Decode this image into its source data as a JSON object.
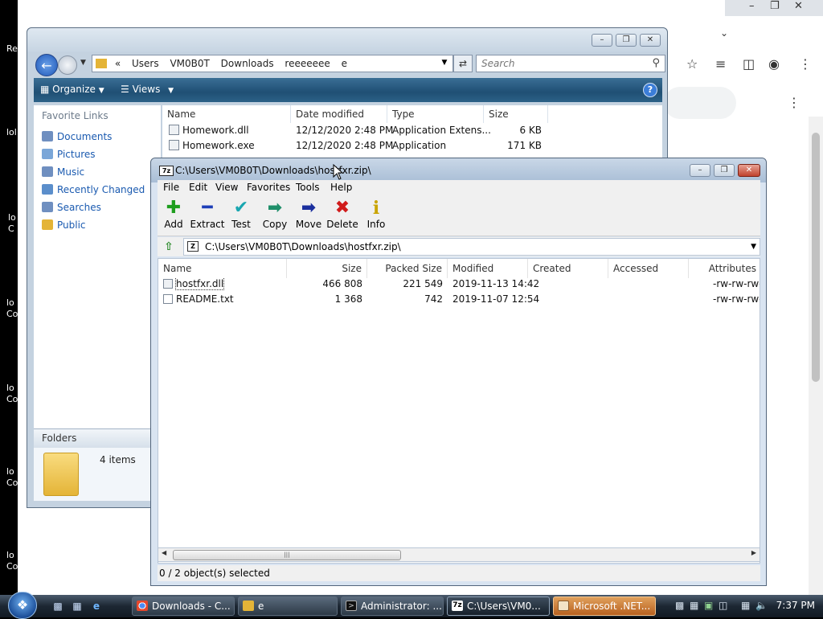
{
  "desktop": {
    "labels": [
      "Re",
      "lol",
      "lo\nC",
      "lo\nCo",
      "lo\nCo",
      "lo\nCo",
      "lo\nCo"
    ]
  },
  "explorer": {
    "breadcrumb": [
      "«",
      "Users",
      "VM0B0T",
      "Downloads",
      "reeeeeee",
      "e"
    ],
    "search_placeholder": "Search",
    "organize_label": "Organize",
    "views_label": "Views",
    "favorites_title": "Favorite Links",
    "favorites": [
      {
        "label": "Documents",
        "color": "#6f8fc0"
      },
      {
        "label": "Pictures",
        "color": "#7aa6d8"
      },
      {
        "label": "Music",
        "color": "#6f8fc0"
      },
      {
        "label": "Recently Changed",
        "color": "#5b8ecb"
      },
      {
        "label": "Searches",
        "color": "#6f8fc0"
      },
      {
        "label": "Public",
        "color": "#e4b437"
      }
    ],
    "folders_label": "Folders",
    "items_count": "4 items",
    "columns": [
      "Name",
      "Date modified",
      "Type",
      "Size"
    ],
    "files": [
      {
        "name": "Homework.dll",
        "date": "12/12/2020 2:48 PM",
        "type": "Application Extens...",
        "size": "6 KB"
      },
      {
        "name": "Homework.exe",
        "date": "12/12/2020 2:48 PM",
        "type": "Application",
        "size": "171 KB"
      }
    ]
  },
  "zip": {
    "title": "C:\\Users\\VM0B0T\\Downloads\\hostfxr.zip\\",
    "menu": [
      "File",
      "Edit",
      "View",
      "Favorites",
      "Tools",
      "Help"
    ],
    "toolbar": [
      {
        "label": "Add",
        "glyph": "✚",
        "color": "#1f9e1f"
      },
      {
        "label": "Extract",
        "glyph": "━",
        "color": "#1d3fb8"
      },
      {
        "label": "Test",
        "glyph": "✔",
        "color": "#19a6b0"
      },
      {
        "label": "Copy",
        "glyph": "➡",
        "color": "#1f8f6a"
      },
      {
        "label": "Move",
        "glyph": "➡",
        "color": "#1b2f9e"
      },
      {
        "label": "Delete",
        "glyph": "✖",
        "color": "#d01b1b"
      },
      {
        "label": "Info",
        "glyph": "i",
        "color": "#c9a400"
      }
    ],
    "path": "C:\\Users\\VM0B0T\\Downloads\\hostfxr.zip\\",
    "columns": [
      "Name",
      "Size",
      "Packed Size",
      "Modified",
      "Created",
      "Accessed",
      "Attributes"
    ],
    "files": [
      {
        "name": "hostfxr.dll",
        "size": "466 808",
        "packed": "221 549",
        "modified": "2019-11-13 14:42",
        "attributes": "-rw-rw-rw-"
      },
      {
        "name": "README.txt",
        "size": "1 368",
        "packed": "742",
        "modified": "2019-11-07 12:54",
        "attributes": "-rw-rw-rw-"
      }
    ],
    "status": "0 / 2 object(s) selected"
  },
  "taskbar": {
    "tasks": [
      {
        "label": "Downloads - C...",
        "icon": "chrome-icon",
        "style": "normal"
      },
      {
        "label": "e",
        "icon": "folder-icon",
        "style": "normal"
      },
      {
        "label": "Administrator: ...",
        "icon": "console-icon",
        "style": "normal"
      },
      {
        "label": "C:\\Users\\VM0...",
        "icon": "7zip-icon",
        "style": "active"
      },
      {
        "label": "Microsoft .NET...",
        "icon": "dotnet-icon",
        "style": "flash"
      }
    ],
    "clock": "7:37 PM"
  }
}
